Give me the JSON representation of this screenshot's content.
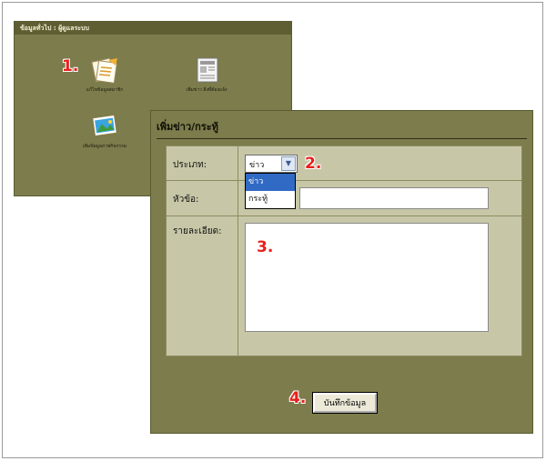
{
  "back_panel": {
    "header": "ข้อมูลทั่วไป : ผู้ดูแลระบบ",
    "icons": [
      {
        "label": "แก้ไขข้อมูลสมาชิก",
        "icon": "document-icon"
      },
      {
        "label": "เพิ่มข่าว สิ่งที่ต้องแจ้ง",
        "icon": "newspaper-icon"
      },
      {
        "label": "เพิ่มข้อมูลภาพกิจกรรม",
        "icon": "photo-icon"
      }
    ]
  },
  "steps": [
    "1.",
    "2.",
    "3.",
    "4."
  ],
  "form": {
    "title": "เพิ่มข่าว/กระทู้",
    "type_label": "ประเภท:",
    "type_value": "ข่าว",
    "type_options": [
      "ข่าว",
      "กระทู้"
    ],
    "subject_label": "หัวข้อ:",
    "subject_value": "",
    "detail_label": "รายละเอียด:",
    "detail_value": "",
    "save_label": "บันทึกข้อมูล"
  },
  "colors": {
    "panel": "#7c7c4c",
    "form_bg": "#c7c7a8",
    "step_red": "#e8201c",
    "selected_option": "#316ac5"
  }
}
